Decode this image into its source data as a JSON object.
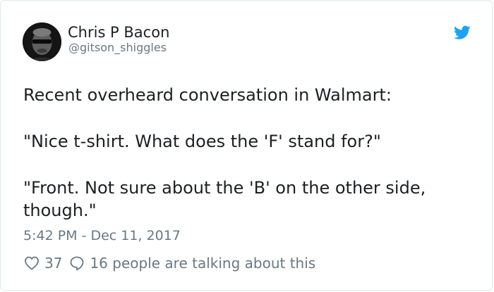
{
  "author": {
    "name": "Chris P Bacon",
    "handle": "@gitson_shiggles",
    "avatar_icon": "avatar-photo"
  },
  "brand": {
    "icon": "twitter-bird-icon",
    "color": "#1da1f2"
  },
  "tweet": {
    "paragraphs": [
      "Recent overheard conversation in Walmart:",
      "\"Nice t-shirt. What does the 'F' stand for?\"",
      "\"Front. Not sure about the 'B' on the other side, though.\""
    ],
    "timestamp": "5:42 PM - Dec 11, 2017"
  },
  "engagement": {
    "likes": "37",
    "like_icon": "heart-icon",
    "reply_icon": "speech-bubble-icon",
    "talking_text": "16 people are talking about this"
  },
  "colors": {
    "text": "#1c2022",
    "muted": "#697882",
    "border": "#e1e8ed"
  }
}
